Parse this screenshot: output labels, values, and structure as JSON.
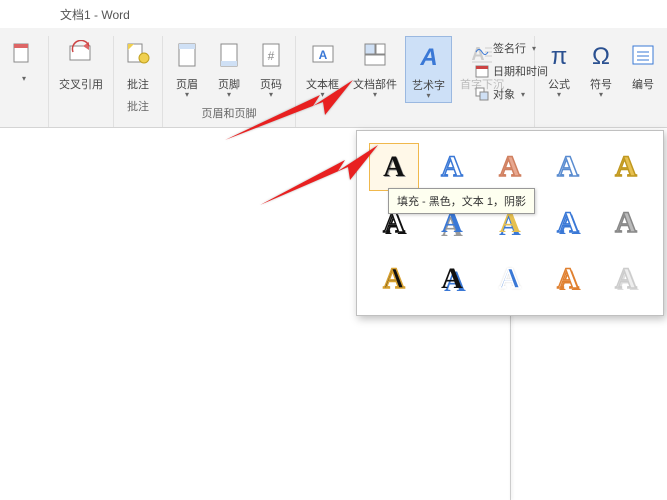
{
  "title": "文档1 - Word",
  "ribbon": {
    "groups": [
      {
        "label": "",
        "items": [
          {
            "label": ""
          }
        ]
      },
      {
        "label": "",
        "items": [
          {
            "label": "交叉引用"
          }
        ]
      },
      {
        "label": "批注",
        "items": [
          {
            "label": "批注"
          }
        ]
      },
      {
        "label": "页眉和页脚",
        "items": [
          {
            "label": "页眉"
          },
          {
            "label": "页脚"
          },
          {
            "label": "页码"
          }
        ]
      },
      {
        "label": "",
        "items": [
          {
            "label": "文本框"
          },
          {
            "label": "文档部件"
          },
          {
            "label": "艺术字"
          },
          {
            "label": "首字下沉"
          }
        ]
      }
    ],
    "right": [
      {
        "label": "公式"
      },
      {
        "label": "符号"
      },
      {
        "label": "编号"
      }
    ]
  },
  "side": [
    {
      "label": "签名行"
    },
    {
      "label": "日期和时间"
    },
    {
      "label": "对象"
    }
  ],
  "tooltip": "填充 - 黑色，文本 1，阴影",
  "wordart": {
    "styles": [
      {
        "fill": "#111",
        "stroke": "none",
        "shadow": "1px 1px 0 #999"
      },
      {
        "fill": "#fff",
        "stroke": "#3a78d6",
        "shadow": "none"
      },
      {
        "fill": "#e8a890",
        "stroke": "#d08060",
        "shadow": "none"
      },
      {
        "fill": "#fff",
        "stroke": "#5a8cd0",
        "shadow": "none"
      },
      {
        "fill": "#e6c050",
        "stroke": "#c09820",
        "shadow": "none"
      },
      {
        "fill": "#fff",
        "stroke": "#111",
        "shadow": "2px 2px 0 #111"
      },
      {
        "fill": "#3a78d6",
        "stroke": "none",
        "shadow": "0 4px 0 #999"
      },
      {
        "fill": "#e6c050",
        "stroke": "none",
        "shadow": "0 3px 0 #3a78d6"
      },
      {
        "fill": "#fff",
        "stroke": "#3a78d6",
        "shadow": "2px 2px 0 #3a78d6"
      },
      {
        "fill": "#bbb",
        "stroke": "#888",
        "shadow": "none"
      },
      {
        "fill": "#111",
        "stroke": "#d6a030",
        "shadow": "0 0 0 2px #d6a030"
      },
      {
        "fill": "#111",
        "stroke": "none",
        "shadow": "3px 3px 0 #3a78d6"
      },
      {
        "fill": "#3a78d6",
        "stroke": "#fff",
        "shadow": "0 0 2px #999"
      },
      {
        "fill": "#fff",
        "stroke": "#e08030",
        "shadow": "2px 2px 0 #e08030"
      },
      {
        "fill": "#eee",
        "stroke": "#ccc",
        "shadow": "2px 2px 0 #ddd"
      }
    ]
  }
}
